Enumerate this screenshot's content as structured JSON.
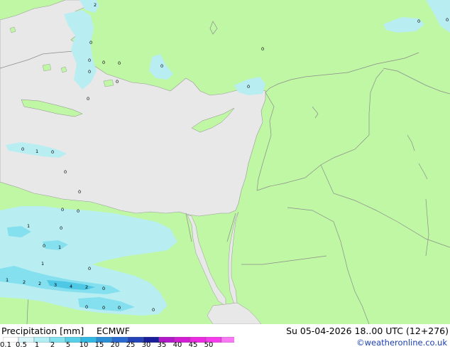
{
  "footer": {
    "title": "Precipitation [mm]",
    "model": "ECMWF",
    "valid_time": "Su 05-04-2026 18..00 UTC (12+276)",
    "copyright": "©weatheronline.co.uk"
  },
  "legend": {
    "ticks": [
      "0.1",
      "0.5",
      "1",
      "2",
      "5",
      "10",
      "15",
      "20",
      "25",
      "30",
      "35",
      "40",
      "45",
      "50"
    ],
    "colors": [
      "#ffffff",
      "#d8f6f9",
      "#b2eef4",
      "#84e1ee",
      "#57cfe8",
      "#33b8e3",
      "#2d8fd6",
      "#2b6ad0",
      "#2543b8",
      "#1a1f9c",
      "#b018c8",
      "#d41ed4",
      "#ec2ae2",
      "#f63cec",
      "#fa78f4"
    ]
  },
  "colors": {
    "sea": "#e8e8e8",
    "land": "#bff7a4",
    "precip_light": "#b8eef2",
    "precip_mid": "#84dfee",
    "precip_strong": "#4fc8e6",
    "border": "#8c8c8c"
  },
  "map": {
    "labels": [
      "2",
      "0",
      "0",
      "0",
      "0",
      "0",
      "0",
      "0",
      "0",
      "0",
      "0",
      "0",
      "0",
      "0",
      "1",
      "0",
      "0",
      "0",
      "0",
      "0",
      "1",
      "0",
      "0",
      "1",
      "1",
      "1",
      "2",
      "2",
      "3",
      "4",
      "2",
      "0",
      "0",
      "0",
      "0",
      "0",
      "0"
    ]
  }
}
